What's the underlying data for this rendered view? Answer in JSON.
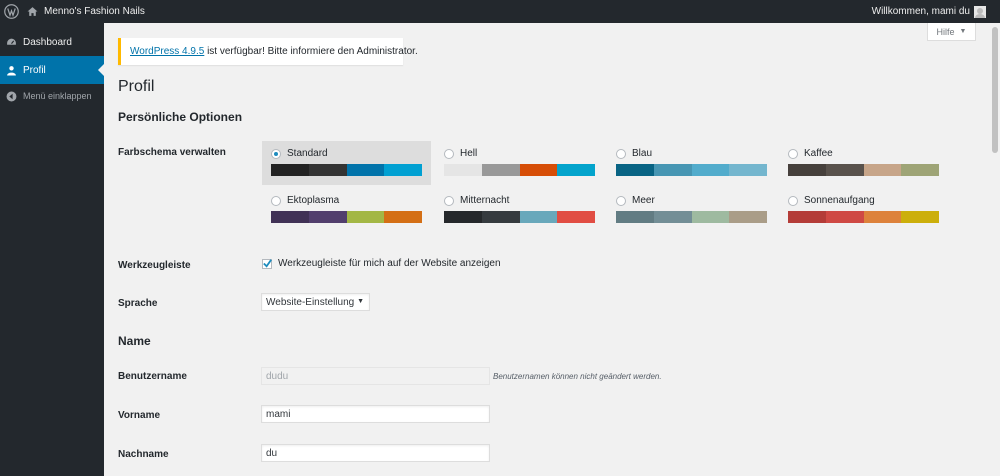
{
  "admin_bar": {
    "site_name": "Menno's Fashion Nails",
    "greeting": "Willkommen, mami du"
  },
  "sidebar": {
    "items": [
      {
        "label": "Dashboard",
        "icon": "dashboard-icon"
      },
      {
        "label": "Profil",
        "icon": "user-icon",
        "active": true
      },
      {
        "label": "Menü einklappen",
        "icon": "collapse-icon"
      }
    ]
  },
  "help_tab": {
    "label": "Hilfe"
  },
  "notice": {
    "link_text": "WordPress 4.9.5",
    "text": " ist verfügbar! Bitte informiere den Administrator."
  },
  "page": {
    "title": "Profil"
  },
  "personal_options": {
    "title": "Persönliche Optionen",
    "color_scheme_label": "Farbschema verwalten",
    "schemes": [
      {
        "name": "Standard",
        "selected": true,
        "colors": [
          "#222222",
          "#333333",
          "#0073aa",
          "#00a0d2"
        ]
      },
      {
        "name": "Hell",
        "selected": false,
        "colors": [
          "#e5e5e5",
          "#999999",
          "#d64e07",
          "#04a4cc"
        ]
      },
      {
        "name": "Blau",
        "selected": false,
        "colors": [
          "#096484",
          "#4796b3",
          "#52accc",
          "#74b6ce"
        ]
      },
      {
        "name": "Kaffee",
        "selected": false,
        "colors": [
          "#46403c",
          "#59524c",
          "#c7a589",
          "#9ea476"
        ]
      },
      {
        "name": "Ektoplasma",
        "selected": false,
        "colors": [
          "#413256",
          "#523f6d",
          "#a3b745",
          "#d46f15"
        ]
      },
      {
        "name": "Mitternacht",
        "selected": false,
        "colors": [
          "#25282b",
          "#363b3f",
          "#69a8bb",
          "#e14d43"
        ]
      },
      {
        "name": "Meer",
        "selected": false,
        "colors": [
          "#627c83",
          "#738e96",
          "#9ebaa0",
          "#aa9d88"
        ]
      },
      {
        "name": "Sonnenaufgang",
        "selected": false,
        "colors": [
          "#b43c38",
          "#cf4944",
          "#dd823b",
          "#ccaf0b"
        ]
      }
    ],
    "toolbar_label": "Werkzeugleiste",
    "toolbar_checkbox_label": "Werkzeugleiste für mich auf der Website anzeigen",
    "toolbar_checked": true,
    "language_label": "Sprache",
    "language_value": "Website-Einstellung"
  },
  "name_section": {
    "title": "Name",
    "username_label": "Benutzername",
    "username_value": "dudu",
    "username_desc": "Benutzernamen können nicht geändert werden.",
    "firstname_label": "Vorname",
    "firstname_value": "mami",
    "lastname_label": "Nachname",
    "lastname_value": "du"
  }
}
